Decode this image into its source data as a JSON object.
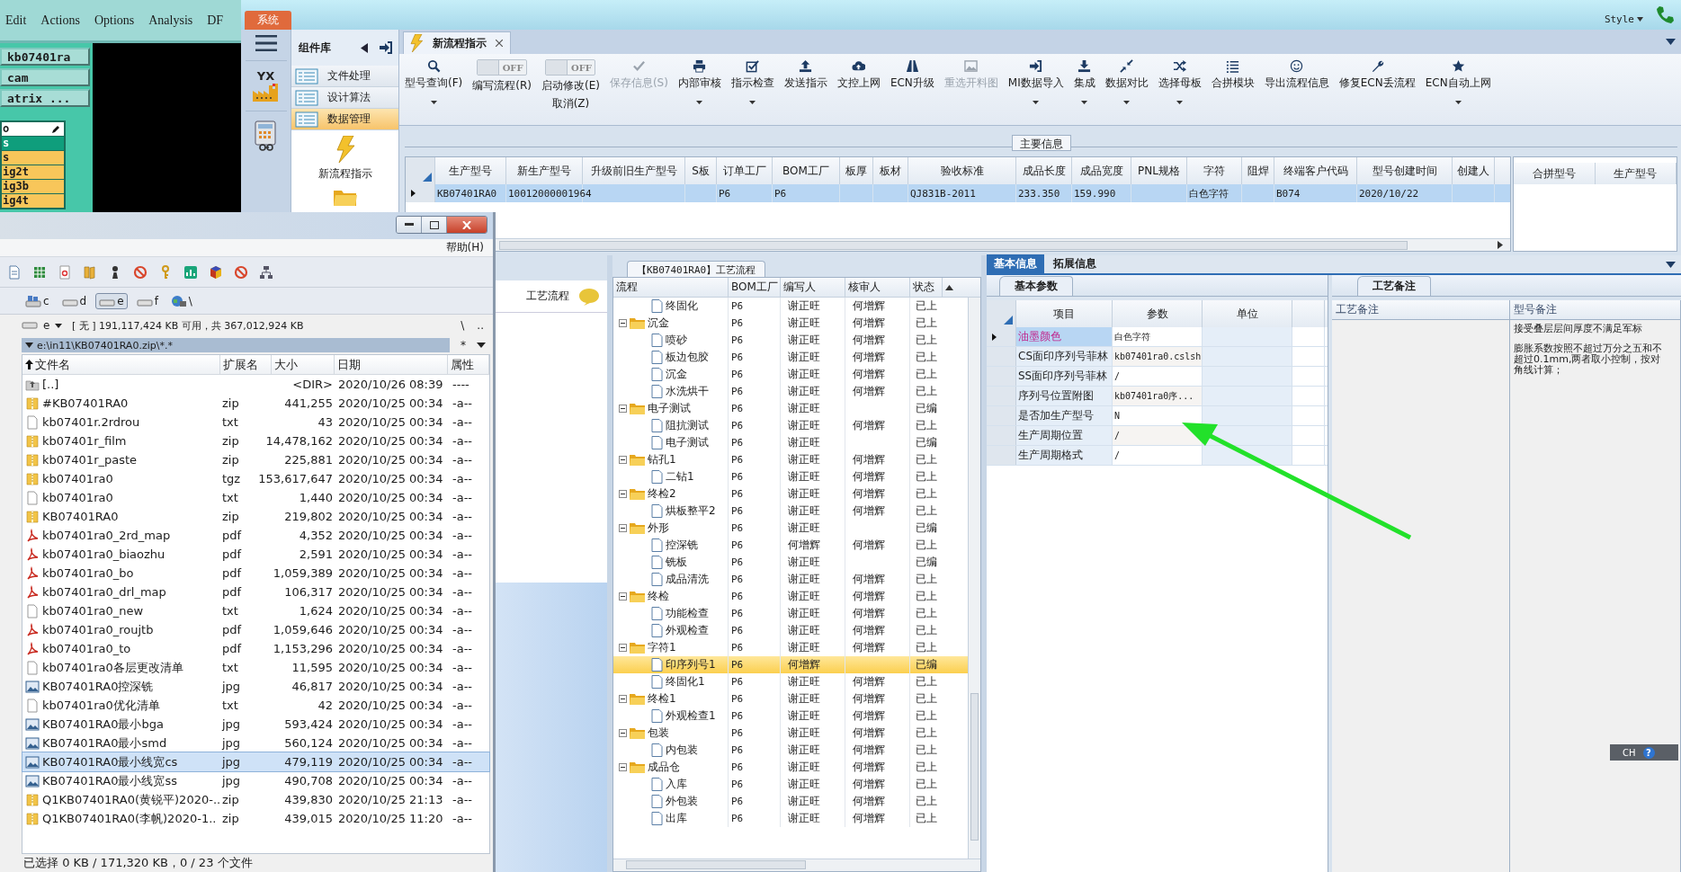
{
  "cam_window": {
    "menu": [
      "Edit",
      "Actions",
      "Options",
      "Analysis",
      "DF"
    ],
    "job_buttons": [
      "kb07401ra",
      "cam",
      "atrix ..."
    ],
    "layers": [
      {
        "kind": "field",
        "label": "o",
        "selected": false
      },
      {
        "kind": "item",
        "label": "s",
        "selected": true
      },
      {
        "kind": "item",
        "label": "s",
        "selected": false
      },
      {
        "kind": "item",
        "label": "ig2t",
        "selected": false
      },
      {
        "kind": "item",
        "label": "ig3b",
        "selected": false
      },
      {
        "kind": "item",
        "label": "ig4t",
        "selected": false
      }
    ]
  },
  "app": {
    "system_tab": "系统",
    "style_menu": "Style",
    "logo_text": "YX",
    "component_library": {
      "title": "组件库",
      "groups": [
        {
          "label": "文件处理",
          "selected": false
        },
        {
          "label": "设计算法",
          "selected": false
        },
        {
          "label": "数据管理",
          "selected": true
        }
      ],
      "tools": [
        {
          "kind": "lightning",
          "label": "新流程指示"
        },
        {
          "kind": "folder"
        }
      ]
    },
    "document_tab": "新流程指示",
    "toolbar": [
      {
        "kind": "button",
        "label": "型号查询(F)",
        "dropdown": true,
        "disabled": false
      },
      {
        "kind": "toggle",
        "label": "编写流程(R)",
        "switch_text": "OFF",
        "on": false
      },
      {
        "kind": "toggle",
        "label": "启动修改(E)",
        "label2": "取消(Z)",
        "switch_text": "OFF",
        "on": false
      },
      {
        "kind": "button",
        "label": "保存信息(S)",
        "dropdown": false,
        "disabled": true
      },
      {
        "kind": "button",
        "label": "内部审核",
        "dropdown": true,
        "disabled": false
      },
      {
        "kind": "button",
        "label": "指示检查",
        "dropdown": true,
        "disabled": false
      },
      {
        "kind": "button",
        "label": "发送指示",
        "dropdown": false,
        "disabled": false
      },
      {
        "kind": "button",
        "label": "文控上网",
        "dropdown": false,
        "disabled": false
      },
      {
        "kind": "button",
        "label": "ECN升级",
        "dropdown": false,
        "disabled": false
      },
      {
        "kind": "button",
        "label": "重选开料图",
        "dropdown": false,
        "disabled": true
      },
      {
        "kind": "button",
        "label": "MI数据导入",
        "dropdown": true,
        "disabled": false
      },
      {
        "kind": "button",
        "label": "集成",
        "dropdown": true,
        "disabled": false
      },
      {
        "kind": "button",
        "label": "数据对比",
        "dropdown": true,
        "disabled": false
      },
      {
        "kind": "button",
        "label": "选择母板",
        "dropdown": true,
        "disabled": false
      },
      {
        "kind": "button",
        "label": "合拼模块",
        "dropdown": false,
        "disabled": false
      },
      {
        "kind": "button",
        "label": "导出流程信息",
        "dropdown": false,
        "disabled": false
      },
      {
        "kind": "button",
        "label": "修复ECN丢流程",
        "dropdown": false,
        "disabled": false
      },
      {
        "kind": "button",
        "label": "ECN自动上网",
        "dropdown": true,
        "disabled": false
      }
    ],
    "main_info": {
      "title": "主要信息",
      "columns": [
        "生产型号",
        "新生产型号",
        "升级前旧生产型号",
        "S板",
        "订单工厂",
        "BOM工厂",
        "板厚",
        "板材",
        "验收标准",
        "成品长度",
        "成品宽度",
        "PNL规格",
        "字符",
        "阻焊",
        "终端客户代码",
        "型号创建时间",
        "创建人"
      ],
      "rows": [
        {
          "selected": true,
          "cells": [
            "KB07401RA0",
            "10012000001964",
            null,
            null,
            "P6",
            "P6",
            null,
            null,
            "QJ831B-2011",
            "233.350",
            "159.990",
            null,
            "白色字符",
            null,
            "B074",
            "2020/10/22",
            null
          ]
        }
      ],
      "merge_columns": [
        "合拼型号",
        "生产型号"
      ]
    },
    "left_panel": {
      "title": "工艺流程"
    },
    "process": {
      "title": "【KB07401RA0】工艺流程",
      "columns": [
        "流程",
        "BOM工厂",
        "编写人",
        "核审人",
        "状态"
      ],
      "tree": [
        {
          "children": [
            {
              "name": "终固化",
              "bom": "P6",
              "writer": "谢正旺",
              "reviewer": "何增辉",
              "status": "已上",
              "selected": false
            }
          ]
        },
        {
          "name": "沉金",
          "bom": "P6",
          "writer": "谢正旺",
          "reviewer": "何增辉",
          "status": "已上",
          "selected": false,
          "expanded": true,
          "children": [
            {
              "name": "喷砂",
              "bom": "P6",
              "writer": "谢正旺",
              "reviewer": "何增辉",
              "status": "已上",
              "selected": false
            },
            {
              "name": "板边包胶",
              "bom": "P6",
              "writer": "谢正旺",
              "reviewer": "何增辉",
              "status": "已上",
              "selected": false
            },
            {
              "name": "沉金",
              "bom": "P6",
              "writer": "谢正旺",
              "reviewer": "何增辉",
              "status": "已上",
              "selected": false
            },
            {
              "name": "水洗烘干",
              "bom": "P6",
              "writer": "谢正旺",
              "reviewer": "何增辉",
              "status": "已上",
              "selected": false
            }
          ]
        },
        {
          "name": "电子测试",
          "bom": "P6",
          "writer": "谢正旺",
          "status": "已编",
          "selected": false,
          "expanded": true,
          "children": [
            {
              "name": "阻抗测试",
              "bom": "P6",
              "writer": "谢正旺",
              "reviewer": "何增辉",
              "status": "已上",
              "selected": false
            },
            {
              "name": "电子测试",
              "bom": "P6",
              "writer": "谢正旺",
              "status": "已编",
              "selected": false
            }
          ]
        },
        {
          "name": "钻孔1",
          "bom": "P6",
          "writer": "谢正旺",
          "reviewer": "何增辉",
          "status": "已上",
          "selected": false,
          "expanded": true,
          "children": [
            {
              "name": "二钻1",
              "bom": "P6",
              "writer": "谢正旺",
              "reviewer": "何增辉",
              "status": "已上",
              "selected": false
            }
          ]
        },
        {
          "name": "终检2",
          "bom": "P6",
          "writer": "谢正旺",
          "reviewer": "何增辉",
          "status": "已上",
          "selected": false,
          "expanded": true,
          "children": [
            {
              "name": "烘板整平2",
              "bom": "P6",
              "writer": "谢正旺",
              "reviewer": "何增辉",
              "status": "已上",
              "selected": false
            }
          ]
        },
        {
          "name": "外形",
          "bom": "P6",
          "writer": "谢正旺",
          "status": "已编",
          "selected": false,
          "expanded": true,
          "children": [
            {
              "name": "控深铣",
              "bom": "P6",
              "writer": "何增辉",
              "reviewer": "何增辉",
              "status": "已上",
              "selected": false
            },
            {
              "name": "铣板",
              "bom": "P6",
              "writer": "谢正旺",
              "status": "已编",
              "selected": false
            },
            {
              "name": "成品清洗",
              "bom": "P6",
              "writer": "谢正旺",
              "reviewer": "何增辉",
              "status": "已上",
              "selected": false
            }
          ]
        },
        {
          "name": "终检",
          "bom": "P6",
          "writer": "谢正旺",
          "reviewer": "何增辉",
          "status": "已上",
          "selected": false,
          "expanded": true,
          "children": [
            {
              "name": "功能检查",
              "bom": "P6",
              "writer": "谢正旺",
              "reviewer": "何增辉",
              "status": "已上",
              "selected": false
            },
            {
              "name": "外观检查",
              "bom": "P6",
              "writer": "谢正旺",
              "reviewer": "何增辉",
              "status": "已上",
              "selected": false
            }
          ]
        },
        {
          "name": "字符1",
          "bom": "P6",
          "writer": "谢正旺",
          "reviewer": "何增辉",
          "status": "已上",
          "selected": false,
          "expanded": true,
          "children": [
            {
              "name": "印序列号1",
              "bom": "P6",
              "writer": "何增辉",
              "status": "已编",
              "selected": true
            },
            {
              "name": "终固化1",
              "bom": "P6",
              "writer": "谢正旺",
              "reviewer": "何增辉",
              "status": "已上",
              "selected": false
            }
          ]
        },
        {
          "name": "终检1",
          "bom": "P6",
          "writer": "谢正旺",
          "reviewer": "何增辉",
          "status": "已上",
          "selected": false,
          "expanded": true,
          "children": [
            {
              "name": "外观检查1",
              "bom": "P6",
              "writer": "谢正旺",
              "reviewer": "何增辉",
              "status": "已上",
              "selected": false
            }
          ]
        },
        {
          "name": "包装",
          "bom": "P6",
          "writer": "谢正旺",
          "reviewer": "何增辉",
          "status": "已上",
          "selected": false,
          "expanded": true,
          "children": [
            {
              "name": "内包装",
              "bom": "P6",
              "writer": "谢正旺",
              "reviewer": "何增辉",
              "status": "已上",
              "selected": false
            }
          ]
        },
        {
          "name": "成品仓",
          "bom": "P6",
          "writer": "谢正旺",
          "reviewer": "何增辉",
          "status": "已上",
          "selected": false,
          "expanded": true,
          "children": [
            {
              "name": "入库",
              "bom": "P6",
              "writer": "谢正旺",
              "reviewer": "何增辉",
              "status": "已上",
              "selected": false
            },
            {
              "name": "外包装",
              "bom": "P6",
              "writer": "谢正旺",
              "reviewer": "何增辉",
              "status": "已上",
              "selected": false
            },
            {
              "name": "出库",
              "bom": "P6",
              "writer": "谢正旺",
              "reviewer": "何增辉",
              "status": "已上",
              "selected": false
            }
          ]
        }
      ]
    },
    "details": {
      "tabs": [
        {
          "label": "基本信息",
          "selected": true
        },
        {
          "label": "拓展信息",
          "selected": false
        }
      ],
      "params": {
        "tab": "基本参数",
        "columns": [
          "项目",
          "参数",
          "单位"
        ],
        "rows": [
          {
            "item": "油墨颜色",
            "value": "白色字符",
            "selected": true
          },
          {
            "item": "CS面印序列号菲林",
            "value": "kb07401ra0.cslsh",
            "selected": false
          },
          {
            "item": "SS面印序列号菲林",
            "value": "/",
            "selected": false
          },
          {
            "item": "序列号位置附图",
            "value": "kb07401ra0序...",
            "selected": false
          },
          {
            "item": "是否加生产型号",
            "value": "N",
            "selected": false
          },
          {
            "item": "生产周期位置",
            "value": "/",
            "selected": false
          },
          {
            "item": "生产周期格式",
            "value": "/",
            "selected": false
          }
        ]
      },
      "notes": {
        "tab": "工艺备注",
        "columns": [
          "工艺备注",
          "型号备注"
        ],
        "model_notes": [
          "接受叠层层间厚度不满足军标",
          "膨胀系数按照不超过万分之五和不超过0.1mm,两者取小控制，按对角线计算；"
        ]
      }
    },
    "ime": {
      "label": "CH",
      "help": "?"
    }
  },
  "file_manager": {
    "menu": [
      "帮助(H)"
    ],
    "drives": [
      {
        "label": "c",
        "kind": "system",
        "selected": false
      },
      {
        "label": "d",
        "kind": "disk",
        "selected": false
      },
      {
        "label": "e",
        "kind": "disk",
        "selected": true
      },
      {
        "label": "f",
        "kind": "disk",
        "selected": false
      },
      {
        "label": "\\",
        "kind": "network",
        "selected": false
      }
    ],
    "drive_select": "e",
    "free_space": "[ 无 ] 191,117,424 KB 可用，共 367,012,924 KB",
    "nav_buttons": [
      "\\",
      ".."
    ],
    "path": "e:\\in11\\KB07401RA0.zip\\*.*",
    "filter": "*",
    "columns": [
      "文件名",
      "扩展名",
      "大小",
      "日期",
      "属性"
    ],
    "files": [
      {
        "kind": "up",
        "name": "[..]",
        "size": "<DIR>",
        "date": "2020/10/26 08:39",
        "attr": "----",
        "selected": false
      },
      {
        "kind": "zip",
        "name": "#KB07401RA0",
        "ext": "zip",
        "size": "441,255",
        "date": "2020/10/25 00:34",
        "attr": "-a--",
        "selected": false
      },
      {
        "kind": "txt",
        "name": "kb07401r.2rdrou",
        "ext": "txt",
        "size": "43",
        "date": "2020/10/25 00:34",
        "attr": "-a--",
        "selected": false
      },
      {
        "kind": "zip",
        "name": "kb07401r_film",
        "ext": "zip",
        "size": "14,478,162",
        "date": "2020/10/25 00:34",
        "attr": "-a--",
        "selected": false
      },
      {
        "kind": "zip",
        "name": "kb07401r_paste",
        "ext": "zip",
        "size": "225,881",
        "date": "2020/10/25 00:34",
        "attr": "-a--",
        "selected": false
      },
      {
        "kind": "zip",
        "name": "kb07401ra0",
        "ext": "tgz",
        "size": "153,617,647",
        "date": "2020/10/25 00:34",
        "attr": "-a--",
        "selected": false
      },
      {
        "kind": "txt",
        "name": "kb07401ra0",
        "ext": "txt",
        "size": "1,440",
        "date": "2020/10/25 00:34",
        "attr": "-a--",
        "selected": false
      },
      {
        "kind": "zip",
        "name": "KB07401RA0",
        "ext": "zip",
        "size": "219,802",
        "date": "2020/10/25 00:34",
        "attr": "-a--",
        "selected": false
      },
      {
        "kind": "pdf",
        "name": "kb07401ra0_2rd_map",
        "ext": "pdf",
        "size": "4,352",
        "date": "2020/10/25 00:34",
        "attr": "-a--",
        "selected": false
      },
      {
        "kind": "pdf",
        "name": "kb07401ra0_biaozhu",
        "ext": "pdf",
        "size": "2,591",
        "date": "2020/10/25 00:34",
        "attr": "-a--",
        "selected": false
      },
      {
        "kind": "pdf",
        "name": "kb07401ra0_bo",
        "ext": "pdf",
        "size": "1,059,389",
        "date": "2020/10/25 00:34",
        "attr": "-a--",
        "selected": false
      },
      {
        "kind": "pdf",
        "name": "kb07401ra0_drl_map",
        "ext": "pdf",
        "size": "106,317",
        "date": "2020/10/25 00:34",
        "attr": "-a--",
        "selected": false
      },
      {
        "kind": "txt",
        "name": "kb07401ra0_new",
        "ext": "txt",
        "size": "1,624",
        "date": "2020/10/25 00:34",
        "attr": "-a--",
        "selected": false
      },
      {
        "kind": "pdf",
        "name": "kb07401ra0_roujtb",
        "ext": "pdf",
        "size": "1,059,646",
        "date": "2020/10/25 00:34",
        "attr": "-a--",
        "selected": false
      },
      {
        "kind": "pdf",
        "name": "kb07401ra0_to",
        "ext": "pdf",
        "size": "1,153,296",
        "date": "2020/10/25 00:34",
        "attr": "-a--",
        "selected": false
      },
      {
        "kind": "txt",
        "name": "kb07401ra0各层更改清单",
        "ext": "txt",
        "size": "11,595",
        "date": "2020/10/25 00:34",
        "attr": "-a--",
        "selected": false
      },
      {
        "kind": "jpg",
        "name": "KB07401RA0控深铣",
        "ext": "jpg",
        "size": "46,817",
        "date": "2020/10/25 00:34",
        "attr": "-a--",
        "selected": false
      },
      {
        "kind": "txt",
        "name": "kb07401ra0优化清单",
        "ext": "txt",
        "size": "42",
        "date": "2020/10/25 00:34",
        "attr": "-a--",
        "selected": false
      },
      {
        "kind": "jpg",
        "name": "KB07401RA0最小bga",
        "ext": "jpg",
        "size": "593,424",
        "date": "2020/10/25 00:34",
        "attr": "-a--",
        "selected": false
      },
      {
        "kind": "jpg",
        "name": "KB07401RA0最小smd",
        "ext": "jpg",
        "size": "560,124",
        "date": "2020/10/25 00:34",
        "attr": "-a--",
        "selected": false
      },
      {
        "kind": "jpg",
        "name": "KB07401RA0最小线宽cs",
        "ext": "jpg",
        "size": "479,119",
        "date": "2020/10/25 00:34",
        "attr": "-a--",
        "selected": true
      },
      {
        "kind": "jpg",
        "name": "KB07401RA0最小线宽ss",
        "ext": "jpg",
        "size": "490,708",
        "date": "2020/10/25 00:34",
        "attr": "-a--",
        "selected": false
      },
      {
        "kind": "zip",
        "name": "Q1KB07401RA0(黄锐平)2020-..",
        "ext": "zip",
        "size": "439,830",
        "date": "2020/10/25 21:13",
        "attr": "-a--",
        "selected": false
      },
      {
        "kind": "zip",
        "name": "Q1KB07401RA0(李帆)2020-1..",
        "ext": "zip",
        "size": "439,015",
        "date": "2020/10/25 11:20",
        "attr": "-a--",
        "selected": false
      }
    ],
    "status": "已选择 0 KB / 171,320 KB，0 / 23 个文件"
  }
}
